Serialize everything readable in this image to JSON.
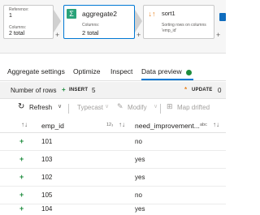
{
  "pipeline": {
    "node1": {
      "reference_label": "Reference:",
      "reference_value": "1",
      "columns_label": "Columns:",
      "columns_value": "2 total"
    },
    "node2": {
      "title": "aggregate2",
      "columns_label": "Columns:",
      "columns_value": "2 total",
      "icon": "sigma-icon"
    },
    "node3": {
      "title": "sort1",
      "description": "Sorting rows on columns 'emp_id'",
      "icon": "sort-icon"
    },
    "plus": "+"
  },
  "tabs": [
    {
      "label": "Aggregate settings"
    },
    {
      "label": "Optimize"
    },
    {
      "label": "Inspect"
    },
    {
      "label": "Data preview",
      "active": true
    }
  ],
  "summary": {
    "rows_label": "Number of rows",
    "insert_icon": "+",
    "insert_label": "INSERT",
    "insert_count": "5",
    "update_icon": "*",
    "update_label": "UPDATE",
    "update_count": "0"
  },
  "toolbar": {
    "refresh_icon": "↻",
    "refresh": "Refresh",
    "typecast": "Typecast",
    "modify": "Modify",
    "map_drifted": "Map drifted",
    "caret": "∨"
  },
  "table": {
    "sort_glyph": "↑↓",
    "columns": [
      {
        "name": "emp_id",
        "type": "12₃"
      },
      {
        "name": "need_improvement...",
        "type": "abc"
      }
    ],
    "row_marker": "+",
    "rows": [
      {
        "emp_id": "101",
        "need_improvement": "no"
      },
      {
        "emp_id": "103",
        "need_improvement": "yes"
      },
      {
        "emp_id": "102",
        "need_improvement": "yes"
      },
      {
        "emp_id": "105",
        "need_improvement": "no"
      },
      {
        "emp_id": "104",
        "need_improvement": "yes"
      }
    ]
  },
  "colors": {
    "accent": "#0078d4",
    "insert": "#1e8c3e",
    "update": "#e8821e"
  }
}
